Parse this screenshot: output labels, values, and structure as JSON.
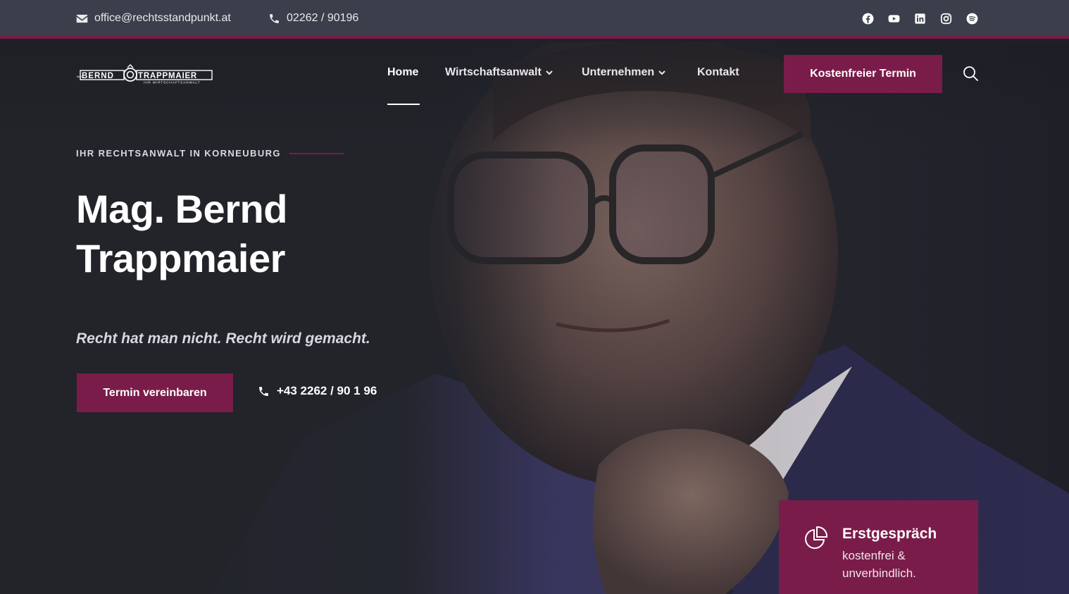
{
  "topbar": {
    "email": "office@rechtsstandpunkt.at",
    "phone": "02262 / 90196",
    "social": [
      "facebook-icon",
      "youtube-icon",
      "linkedin-icon",
      "instagram-icon",
      "spotify-icon"
    ]
  },
  "logo": {
    "first_name": "BERND",
    "last_name": "TRAPPMAIER",
    "prefix": "MAG.",
    "subline": "IHR WIRTSCHAFTSANWALT"
  },
  "nav": {
    "items": [
      {
        "label": "Home",
        "active": true
      },
      {
        "label": "Wirtschaftsanwalt",
        "dropdown": true
      },
      {
        "label": "Unternehmen",
        "dropdown": true
      },
      {
        "label": "Kontakt"
      }
    ],
    "cta": "Kostenfreier Termin"
  },
  "hero": {
    "eyebrow": "IHR RECHTSANWALT IN KORNEUBURG",
    "title_line1": "Mag. Bernd",
    "title_line2": "Trappmaier",
    "tagline": "Recht hat man nicht. Recht wird gemacht.",
    "button": "Termin vereinbaren",
    "phone": "+43 2262 / 90 1 96"
  },
  "card": {
    "title": "Erstgespräch",
    "subtitle": "kostenfrei & unverbindlich."
  },
  "colors": {
    "accent": "#7a1c49",
    "topbar": "#3b3f4b",
    "background": "#22242a"
  }
}
